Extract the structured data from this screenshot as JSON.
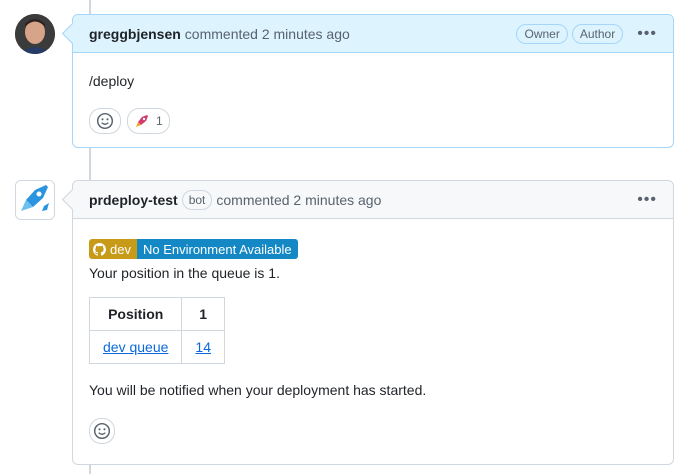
{
  "comment1": {
    "author": "greggbjensen",
    "action": "commented",
    "time": "2 minutes ago",
    "labels": [
      "Owner",
      "Author"
    ],
    "body": "/deploy",
    "reaction_rocket_count": "1"
  },
  "comment2": {
    "author": "prdeploy-test",
    "bot_label": "bot",
    "action": "commented",
    "time": "2 minutes ago",
    "env_left": "dev",
    "env_right": "No Environment Available",
    "queue_text": "Your position in the queue is 1.",
    "table": {
      "headers": [
        "Position",
        "1"
      ],
      "row": [
        "dev queue",
        "14"
      ]
    },
    "notify_text": "You will be notified when your deployment has started."
  },
  "colors": {
    "header_highlight": "#ddf4ff",
    "env_left": "#c79a17",
    "env_right": "#1388c5",
    "link": "#0969da"
  }
}
